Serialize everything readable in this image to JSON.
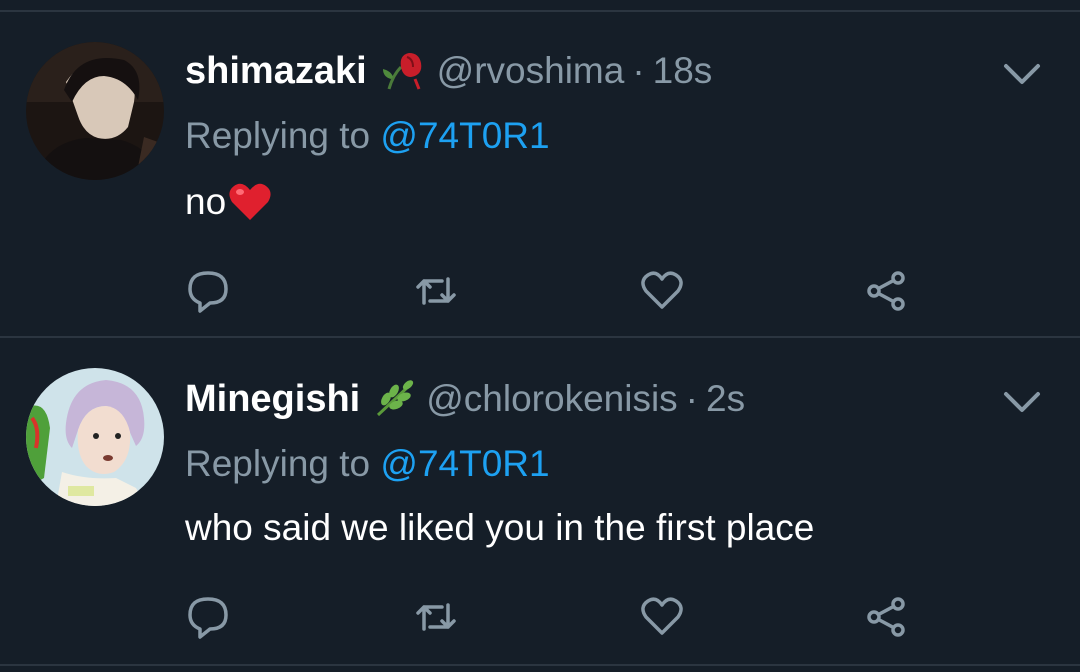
{
  "tweets": [
    {
      "display_name": "shimazaki",
      "badge_icon": "wilted-rose-icon",
      "handle": "@rvoshima",
      "separator": "·",
      "time": "18s",
      "replying_prefix": "Replying to",
      "replying_to": "@74T0R1",
      "text": "no",
      "text_emoji": "red-heart-icon",
      "actions": [
        "reply-icon",
        "retweet-icon",
        "like-icon",
        "share-icon"
      ]
    },
    {
      "display_name": "Minegishi",
      "badge_icon": "herb-icon",
      "handle": "@chlorokenisis",
      "separator": "·",
      "time": "2s",
      "replying_prefix": "Replying to",
      "replying_to": "@74T0R1",
      "text": "who said we liked you in the first place",
      "actions": [
        "reply-icon",
        "retweet-icon",
        "like-icon",
        "share-icon"
      ]
    }
  ],
  "colors": {
    "background": "#151e28",
    "divider": "#2b3540",
    "muted": "#8899a6",
    "link": "#1da1f2",
    "text": "#ffffff"
  }
}
